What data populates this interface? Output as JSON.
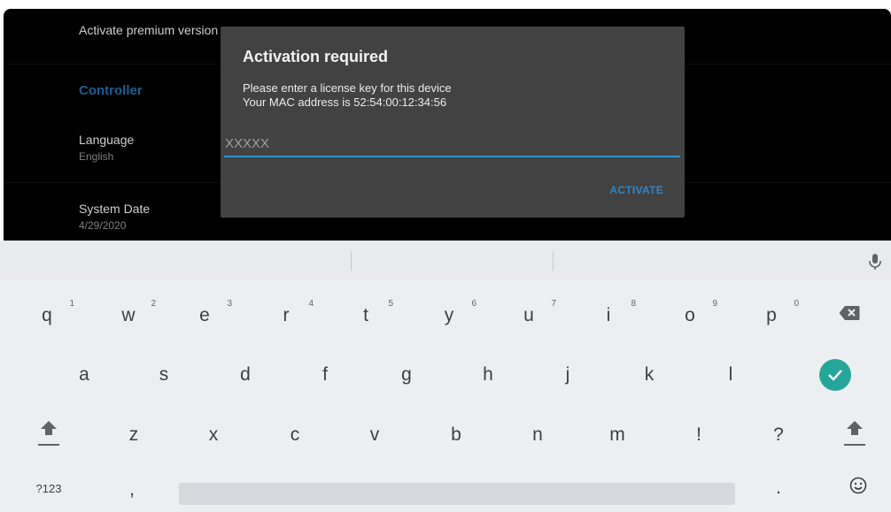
{
  "settings": {
    "premium_title": "Activate premium version",
    "section_header": "Controller",
    "language_title": "Language",
    "language_value": "English",
    "date_title": "System Date",
    "date_value": "4/29/2020"
  },
  "dialog": {
    "title": "Activation required",
    "line1": "Please enter a license key for this device",
    "line2": "Your MAC address is 52:54:00:12:34:56",
    "input_placeholder": "XXXXX",
    "activate_label": "ACTIVATE"
  },
  "keyboard": {
    "row1": [
      {
        "ch": "q",
        "hint": "1"
      },
      {
        "ch": "w",
        "hint": "2"
      },
      {
        "ch": "e",
        "hint": "3"
      },
      {
        "ch": "r",
        "hint": "4"
      },
      {
        "ch": "t",
        "hint": "5"
      },
      {
        "ch": "y",
        "hint": "6"
      },
      {
        "ch": "u",
        "hint": "7"
      },
      {
        "ch": "i",
        "hint": "8"
      },
      {
        "ch": "o",
        "hint": "9"
      },
      {
        "ch": "p",
        "hint": "0"
      }
    ],
    "row2": [
      "a",
      "s",
      "d",
      "f",
      "g",
      "h",
      "j",
      "k",
      "l"
    ],
    "row3": [
      "z",
      "x",
      "c",
      "v",
      "b",
      "n",
      "m",
      "!",
      "?"
    ],
    "symbols_label": "?123",
    "comma": ",",
    "period": ".",
    "icons": {
      "mic": "microphone-icon",
      "backspace": "backspace-icon",
      "enter": "check-icon",
      "shift": "shift-icon",
      "emoji": "emoji-icon"
    },
    "colors": {
      "enter_accent": "#26a69a",
      "input_underline": "#2f8fcf",
      "activate_text": "#2e86c9"
    }
  }
}
